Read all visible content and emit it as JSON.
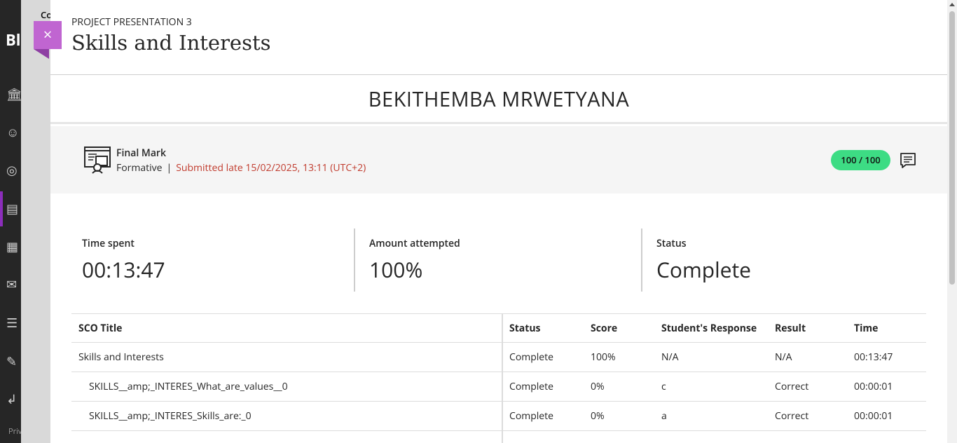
{
  "background": {
    "brand_text": "Bl",
    "crumb_text": "Co",
    "privacy_text": "Priv",
    "nav_icons": [
      "institution-icon",
      "user-icon",
      "globe-icon",
      "courses-icon",
      "calendar-icon",
      "mail-icon",
      "grades-icon",
      "tools-icon",
      "sign-out-icon"
    ]
  },
  "panel": {
    "kicker": "PROJECT PRESENTATION 3",
    "title": "Skills and Interests",
    "close_label": "×"
  },
  "student": {
    "name": "BEKITHEMBA MRWETYANA"
  },
  "mark": {
    "label": "Final Mark",
    "type": "Formative",
    "separator": "|",
    "submission": "Submitted late 15/02/2025, 13:11 (UTC+2)",
    "grade": "100 / 100"
  },
  "stats": [
    {
      "label": "Time spent",
      "value": "00:13:47"
    },
    {
      "label": "Amount attempted",
      "value": "100%"
    },
    {
      "label": "Status",
      "value": "Complete"
    }
  ],
  "table": {
    "headers": [
      "SCO Title",
      "Status",
      "Score",
      "Student's Response",
      "Result",
      "Time"
    ],
    "rows": [
      [
        "Skills and Interests",
        "Complete",
        "100%",
        "N/A",
        "N/A",
        "00:13:47"
      ],
      [
        "SKILLS__amp;_INTERES_What_are_values__0",
        "Complete",
        "0%",
        "c",
        "Correct",
        "00:00:01"
      ],
      [
        "SKILLS__amp;_INTERES_Skills_are:_0",
        "Complete",
        "0%",
        "a",
        "Correct",
        "00:00:01"
      ]
    ]
  },
  "colors": {
    "accent": "#c065d1",
    "late": "#c0392b",
    "grade_pill": "#3ddc84"
  }
}
